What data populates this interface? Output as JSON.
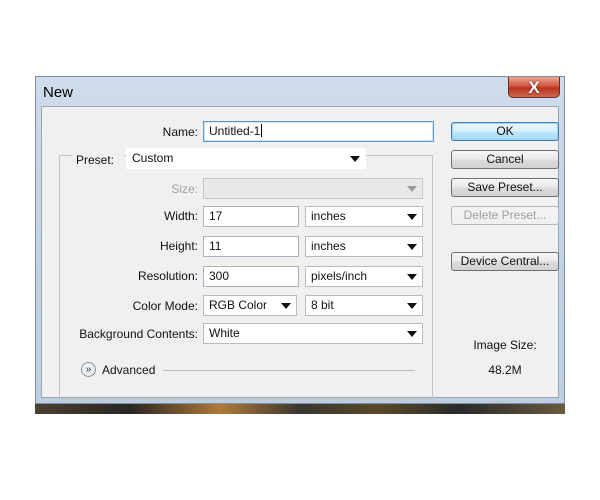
{
  "window": {
    "title": "New",
    "close_glyph": "X"
  },
  "form": {
    "name_label": "Name:",
    "name_value": "Untitled-1",
    "preset_label": "Preset:",
    "preset_value": "Custom",
    "size_label": "Size:",
    "size_value": "",
    "width_label": "Width:",
    "width_value": "17",
    "width_unit": "inches",
    "height_label": "Height:",
    "height_value": "11",
    "height_unit": "inches",
    "resolution_label": "Resolution:",
    "resolution_value": "300",
    "resolution_unit": "pixels/inch",
    "color_mode_label": "Color Mode:",
    "color_mode_value": "RGB Color",
    "bit_depth_value": "8 bit",
    "background_label": "Background Contents:",
    "background_value": "White",
    "advanced_label": "Advanced"
  },
  "buttons": {
    "ok": "OK",
    "cancel": "Cancel",
    "save_preset": "Save Preset...",
    "delete_preset": "Delete Preset...",
    "device_central": "Device Central..."
  },
  "info": {
    "image_size_label": "Image Size:",
    "image_size_value": "48.2M"
  },
  "icons": {
    "close": "close-icon",
    "dropdown": "chevron-down-icon",
    "advanced_toggle": "double-chevron-down-icon"
  }
}
